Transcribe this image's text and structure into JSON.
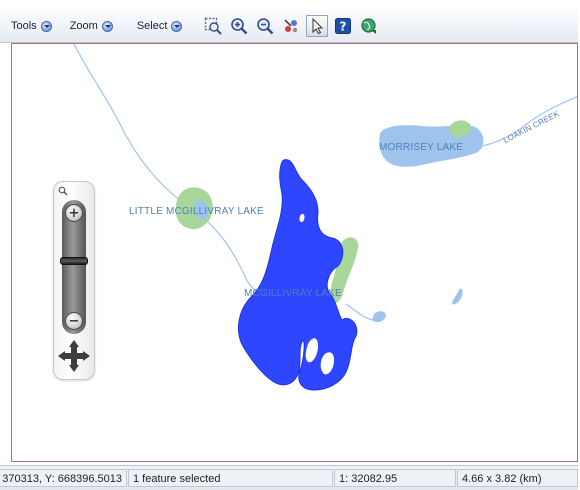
{
  "toolbar": {
    "menus": [
      {
        "label": "Tools"
      },
      {
        "label": "Zoom"
      },
      {
        "label": "Select"
      }
    ],
    "buttons": [
      {
        "icon": "zoom-extent-icon"
      },
      {
        "icon": "zoom-in-icon"
      },
      {
        "icon": "zoom-out-icon"
      },
      {
        "icon": "identify-icon"
      },
      {
        "icon": "pointer-icon",
        "active": true
      },
      {
        "icon": "help-icon"
      },
      {
        "icon": "globe-refresh-icon"
      }
    ]
  },
  "map": {
    "labels": {
      "morrisey": "MORRISEY LAKE",
      "creek": "LOAKIN CREEK",
      "little_mcgillivray": "LITTLE MCGILLIVRAY LAKE",
      "mcgillivray": "MCGILLIVRAY LAKE"
    },
    "colors": {
      "selected_lake": "#2f46ff",
      "lake": "#9ec4ee",
      "wetland": "#a9d79a",
      "stream": "#9ec4ee",
      "frame_border": "#b56a80"
    }
  },
  "zoom_control": {
    "level": 0.58
  },
  "statusbar": {
    "coords": "370313, Y: 668396.5013",
    "selection": "1 feature selected",
    "scale": "1: 32082.95",
    "extent": "4.66 x 3.82 (km)"
  }
}
